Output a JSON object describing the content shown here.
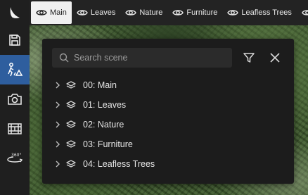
{
  "tabs": [
    {
      "label": "Main",
      "selected": true,
      "icon": "eye-icon"
    },
    {
      "label": "Leaves",
      "selected": false,
      "icon": "eye-icon"
    },
    {
      "label": "Nature",
      "selected": false,
      "icon": "eye-icon"
    },
    {
      "label": "Furniture",
      "selected": false,
      "icon": "eye-icon"
    },
    {
      "label": "Leafless Trees",
      "selected": false,
      "icon": "eye-icon"
    }
  ],
  "sidebar": {
    "items": [
      {
        "name": "logo",
        "icon": "app-logo-icon"
      },
      {
        "name": "save",
        "icon": "save-icon"
      },
      {
        "name": "scene",
        "icon": "scene-objects-icon",
        "active": true
      },
      {
        "name": "camera",
        "icon": "camera-icon"
      },
      {
        "name": "animation",
        "icon": "film-icon"
      },
      {
        "name": "view-360",
        "icon": "rotate-360-icon",
        "badge": "360°"
      }
    ]
  },
  "panel": {
    "search_placeholder": "Search scene",
    "scenes": [
      {
        "label": "00: Main"
      },
      {
        "label": "01: Leaves"
      },
      {
        "label": "02: Nature"
      },
      {
        "label": "03: Furniture"
      },
      {
        "label": "04: Leafless Trees"
      }
    ]
  },
  "colors": {
    "sidebar_bg": "#1f1f1f",
    "tabbar_bg": "#232323",
    "active_tool": "#2e5e9e",
    "panel_bg": "#1c1c1c",
    "selected_tab_bg": "#f0f0f0"
  }
}
